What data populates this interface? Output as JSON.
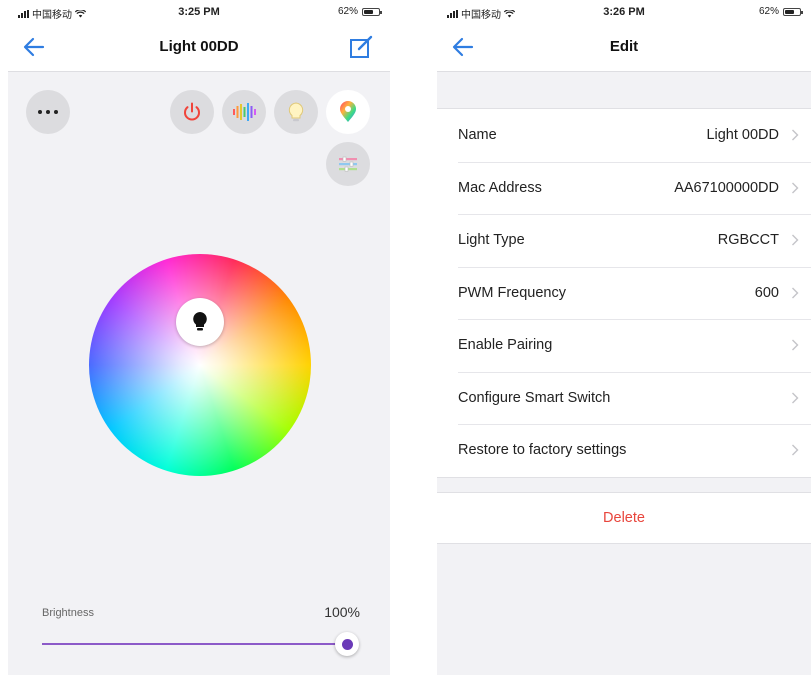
{
  "left_screen": {
    "status": {
      "carrier": "中国移动",
      "time": "3:25 PM",
      "battery": "62%"
    },
    "title": "Light 00DD",
    "modes": {
      "more": "more-icon",
      "power": "power-icon",
      "music": "music-rhythm-icon",
      "white": "white-light-icon",
      "color": "color-palette-icon",
      "scene": "scene-icon"
    },
    "brightness": {
      "label": "Brightness",
      "value": "100%",
      "level": 1.0
    },
    "accent": "#6a3ab8"
  },
  "right_screen": {
    "status": {
      "carrier": "中国移动",
      "time": "3:26 PM",
      "battery": "62%"
    },
    "title": "Edit",
    "settings": [
      {
        "label": "Name",
        "value": "Light 00DD"
      },
      {
        "label": "Mac Address",
        "value": "AA67100000DD"
      },
      {
        "label": "Light Type",
        "value": "RGBCCT"
      },
      {
        "label": "PWM Frequency",
        "value": "600"
      },
      {
        "label": "Enable Pairing",
        "value": ""
      },
      {
        "label": "Configure Smart Switch",
        "value": ""
      },
      {
        "label": "Restore to factory settings",
        "value": ""
      }
    ],
    "delete_label": "Delete",
    "delete_color": "#e8453c"
  },
  "theme": {
    "back_arrow": "#2f7de1",
    "edit_icon": "#2f7de1"
  }
}
